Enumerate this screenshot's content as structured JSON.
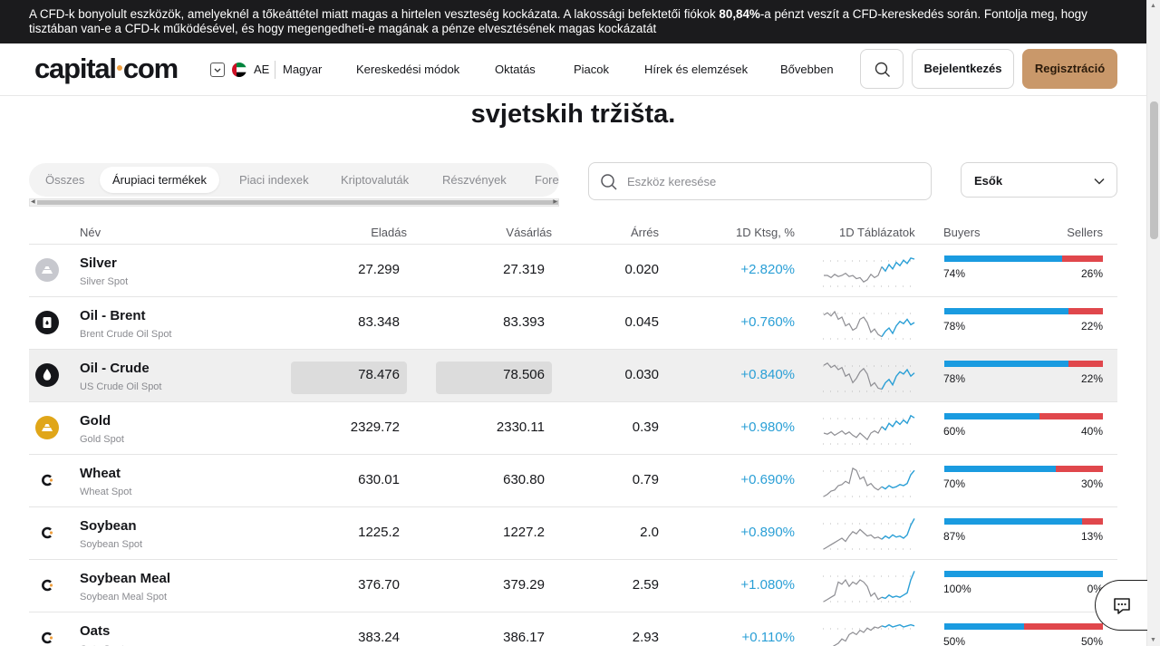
{
  "banner": {
    "text_before": "A CFD-k bonyolult eszközök, amelyeknél a tőkeáttétel miatt magas a hirtelen veszteség kockázata. A lakossági befektetői fiókok ",
    "percent": "80,84%",
    "text_after": "-a pénzt veszít a CFD-kereskedés során. Fontolja meg, hogy tisztában van-e a CFD-k működésével, és hogy megengedheti-e magának a pénze elvesztésének magas kockázatát"
  },
  "header": {
    "logo_left": "capital",
    "logo_right": "com",
    "lang_code": "AE",
    "lang_name": "Magyar",
    "nav": [
      "Kereskedési módok",
      "Oktatás",
      "Piacok",
      "Hírek és elemzések",
      "Bővebben"
    ],
    "login": "Bejelentkezés",
    "register": "Regisztráció"
  },
  "heading": "svjetskih tržišta.",
  "tabs": [
    {
      "label": "Összes",
      "active": false
    },
    {
      "label": "Árupiaci termékek",
      "active": true
    },
    {
      "label": "Piaci indexek",
      "active": false
    },
    {
      "label": "Kriptovaluták",
      "active": false
    },
    {
      "label": "Részvények",
      "active": false
    },
    {
      "label": "Fore",
      "active": false
    }
  ],
  "search": {
    "placeholder": "Eszköz keresése"
  },
  "sort": {
    "selected": "Esők"
  },
  "columns": {
    "name": "Név",
    "sell": "Eladás",
    "buy": "Vásárlás",
    "spread": "Árrés",
    "change": "1D Ktsg, %",
    "chart": "1D Táblázatok",
    "buyers": "Buyers",
    "sellers": "Sellers"
  },
  "colors": {
    "accent_blue": "#1a9be0",
    "accent_red": "#e0474c",
    "change_blue": "#2a9fd6",
    "register_bg": "#c9986a",
    "banner_bg": "#1b1b1d"
  },
  "rows": [
    {
      "name": "Silver",
      "sub": "Silver Spot",
      "sell": "27.299",
      "buy": "27.319",
      "spread": "0.020",
      "change": "+2.820%",
      "buyers": "74%",
      "sellers": "26%",
      "buyers_value": 74,
      "icon": "silver-bars-icon",
      "highlight": false,
      "spark": [
        [
          0,
          20
        ],
        [
          1,
          20
        ],
        [
          2,
          22
        ],
        [
          3,
          19
        ],
        [
          4,
          21
        ],
        [
          5,
          20
        ],
        [
          6,
          18
        ],
        [
          7,
          21
        ],
        [
          8,
          20
        ],
        [
          9,
          23
        ],
        [
          10,
          22
        ],
        [
          11,
          26
        ],
        [
          12,
          24
        ],
        [
          13,
          19
        ],
        [
          14,
          22
        ],
        [
          15,
          20
        ],
        [
          16,
          12
        ],
        [
          17,
          16
        ],
        [
          18,
          10
        ],
        [
          19,
          14
        ],
        [
          20,
          8
        ],
        [
          21,
          11
        ],
        [
          22,
          6
        ],
        [
          23,
          9
        ],
        [
          24,
          4
        ],
        [
          25,
          5
        ]
      ]
    },
    {
      "name": "Oil - Brent",
      "sub": "Brent Crude Oil Spot",
      "sell": "83.348",
      "buy": "83.393",
      "spread": "0.045",
      "change": "+0.760%",
      "buyers": "78%",
      "sellers": "22%",
      "buyers_value": 78,
      "icon": "oil-barrel-icon",
      "highlight": false,
      "spark": [
        [
          0,
          8
        ],
        [
          1,
          6
        ],
        [
          2,
          9
        ],
        [
          3,
          5
        ],
        [
          4,
          12
        ],
        [
          5,
          10
        ],
        [
          6,
          18
        ],
        [
          7,
          16
        ],
        [
          8,
          22
        ],
        [
          9,
          20
        ],
        [
          10,
          12
        ],
        [
          11,
          10
        ],
        [
          12,
          15
        ],
        [
          13,
          24
        ],
        [
          14,
          21
        ],
        [
          15,
          26
        ],
        [
          16,
          28
        ],
        [
          17,
          23
        ],
        [
          18,
          20
        ],
        [
          19,
          25
        ],
        [
          20,
          18
        ],
        [
          21,
          14
        ],
        [
          22,
          16
        ],
        [
          23,
          12
        ],
        [
          24,
          17
        ],
        [
          25,
          15
        ]
      ]
    },
    {
      "name": "Oil - Crude",
      "sub": "US Crude Oil Spot",
      "sell": "78.476",
      "buy": "78.506",
      "spread": "0.030",
      "change": "+0.840%",
      "buyers": "78%",
      "sellers": "22%",
      "buyers_value": 78,
      "icon": "oil-drop-icon",
      "highlight": true,
      "spark": [
        [
          0,
          6
        ],
        [
          1,
          4
        ],
        [
          2,
          8
        ],
        [
          3,
          6
        ],
        [
          4,
          10
        ],
        [
          5,
          8
        ],
        [
          6,
          16
        ],
        [
          7,
          14
        ],
        [
          8,
          22
        ],
        [
          9,
          18
        ],
        [
          10,
          12
        ],
        [
          11,
          9
        ],
        [
          12,
          14
        ],
        [
          13,
          25
        ],
        [
          14,
          22
        ],
        [
          15,
          27
        ],
        [
          16,
          28
        ],
        [
          17,
          22
        ],
        [
          18,
          19
        ],
        [
          19,
          24
        ],
        [
          20,
          16
        ],
        [
          21,
          12
        ],
        [
          22,
          14
        ],
        [
          23,
          10
        ],
        [
          24,
          16
        ],
        [
          25,
          13
        ]
      ]
    },
    {
      "name": "Gold",
      "sub": "Gold Spot",
      "sell": "2329.72",
      "buy": "2330.11",
      "spread": "0.39",
      "change": "+0.980%",
      "buyers": "60%",
      "sellers": "40%",
      "buyers_value": 60,
      "icon": "gold-bars-icon",
      "highlight": false,
      "spark": [
        [
          0,
          20
        ],
        [
          1,
          21
        ],
        [
          2,
          19
        ],
        [
          3,
          22
        ],
        [
          4,
          20
        ],
        [
          5,
          18
        ],
        [
          6,
          21
        ],
        [
          7,
          19
        ],
        [
          8,
          22
        ],
        [
          9,
          24
        ],
        [
          10,
          20
        ],
        [
          11,
          23
        ],
        [
          12,
          26
        ],
        [
          13,
          20
        ],
        [
          14,
          18
        ],
        [
          15,
          20
        ],
        [
          16,
          14
        ],
        [
          17,
          17
        ],
        [
          18,
          11
        ],
        [
          19,
          14
        ],
        [
          20,
          9
        ],
        [
          21,
          12
        ],
        [
          22,
          8
        ],
        [
          23,
          11
        ],
        [
          24,
          4
        ],
        [
          25,
          6
        ]
      ]
    },
    {
      "name": "Wheat",
      "sub": "Wheat Spot",
      "sell": "630.01",
      "buy": "630.80",
      "spread": "0.79",
      "change": "+0.690%",
      "buyers": "70%",
      "sellers": "30%",
      "buyers_value": 70,
      "icon": "capital-c-icon",
      "highlight": false,
      "spark": [
        [
          0,
          30
        ],
        [
          1,
          28
        ],
        [
          2,
          25
        ],
        [
          3,
          24
        ],
        [
          4,
          20
        ],
        [
          5,
          19
        ],
        [
          6,
          16
        ],
        [
          7,
          18
        ],
        [
          8,
          4
        ],
        [
          9,
          6
        ],
        [
          10,
          14
        ],
        [
          11,
          12
        ],
        [
          12,
          20
        ],
        [
          13,
          18
        ],
        [
          14,
          22
        ],
        [
          15,
          24
        ],
        [
          16,
          21
        ],
        [
          17,
          23
        ],
        [
          18,
          20
        ],
        [
          19,
          22
        ],
        [
          20,
          21
        ],
        [
          21,
          19
        ],
        [
          22,
          20
        ],
        [
          23,
          18
        ],
        [
          24,
          10
        ],
        [
          25,
          6
        ]
      ]
    },
    {
      "name": "Soybean",
      "sub": "Soybean Spot",
      "sell": "1225.2",
      "buy": "1227.2",
      "spread": "2.0",
      "change": "+0.890%",
      "buyers": "87%",
      "sellers": "13%",
      "buyers_value": 87,
      "icon": "capital-c-icon",
      "highlight": false,
      "spark": [
        [
          0,
          30
        ],
        [
          1,
          28
        ],
        [
          2,
          26
        ],
        [
          3,
          24
        ],
        [
          4,
          22
        ],
        [
          5,
          20
        ],
        [
          6,
          23
        ],
        [
          7,
          18
        ],
        [
          8,
          14
        ],
        [
          9,
          16
        ],
        [
          10,
          12
        ],
        [
          11,
          15
        ],
        [
          12,
          18
        ],
        [
          13,
          17
        ],
        [
          14,
          20
        ],
        [
          15,
          19
        ],
        [
          16,
          21
        ],
        [
          17,
          18
        ],
        [
          18,
          20
        ],
        [
          19,
          17
        ],
        [
          20,
          19
        ],
        [
          21,
          18
        ],
        [
          22,
          20
        ],
        [
          23,
          17
        ],
        [
          24,
          8
        ],
        [
          25,
          2
        ]
      ]
    },
    {
      "name": "Soybean Meal",
      "sub": "Soybean Meal Spot",
      "sell": "376.70",
      "buy": "379.29",
      "spread": "2.59",
      "change": "+1.080%",
      "buyers": "100%",
      "sellers": "0%",
      "buyers_value": 100,
      "icon": "capital-c-icon",
      "highlight": false,
      "spark": [
        [
          0,
          30
        ],
        [
          1,
          28
        ],
        [
          2,
          26
        ],
        [
          3,
          24
        ],
        [
          4,
          12
        ],
        [
          5,
          14
        ],
        [
          6,
          10
        ],
        [
          7,
          16
        ],
        [
          8,
          12
        ],
        [
          9,
          14
        ],
        [
          10,
          10
        ],
        [
          11,
          12
        ],
        [
          12,
          16
        ],
        [
          13,
          25
        ],
        [
          14,
          22
        ],
        [
          15,
          28
        ],
        [
          16,
          26
        ],
        [
          17,
          27
        ],
        [
          18,
          24
        ],
        [
          19,
          26
        ],
        [
          20,
          25
        ],
        [
          21,
          26
        ],
        [
          22,
          24
        ],
        [
          23,
          22
        ],
        [
          24,
          10
        ],
        [
          25,
          2
        ]
      ]
    },
    {
      "name": "Oats",
      "sub": "Oats Spot",
      "sell": "383.24",
      "buy": "386.17",
      "spread": "2.93",
      "change": "+0.110%",
      "buyers": "50%",
      "sellers": "50%",
      "buyers_value": 50,
      "icon": "capital-c-icon",
      "highlight": false,
      "spark": [
        [
          0,
          28
        ],
        [
          1,
          26
        ],
        [
          2,
          24
        ],
        [
          3,
          22
        ],
        [
          4,
          20
        ],
        [
          5,
          16
        ],
        [
          6,
          18
        ],
        [
          7,
          12
        ],
        [
          8,
          10
        ],
        [
          9,
          12
        ],
        [
          10,
          8
        ],
        [
          11,
          10
        ],
        [
          12,
          6
        ],
        [
          13,
          8
        ],
        [
          14,
          5
        ],
        [
          15,
          6
        ],
        [
          16,
          4
        ],
        [
          17,
          5
        ],
        [
          18,
          3
        ],
        [
          19,
          5
        ],
        [
          20,
          4
        ],
        [
          21,
          3
        ],
        [
          22,
          5
        ],
        [
          23,
          4
        ],
        [
          24,
          3
        ],
        [
          25,
          4
        ]
      ]
    }
  ]
}
